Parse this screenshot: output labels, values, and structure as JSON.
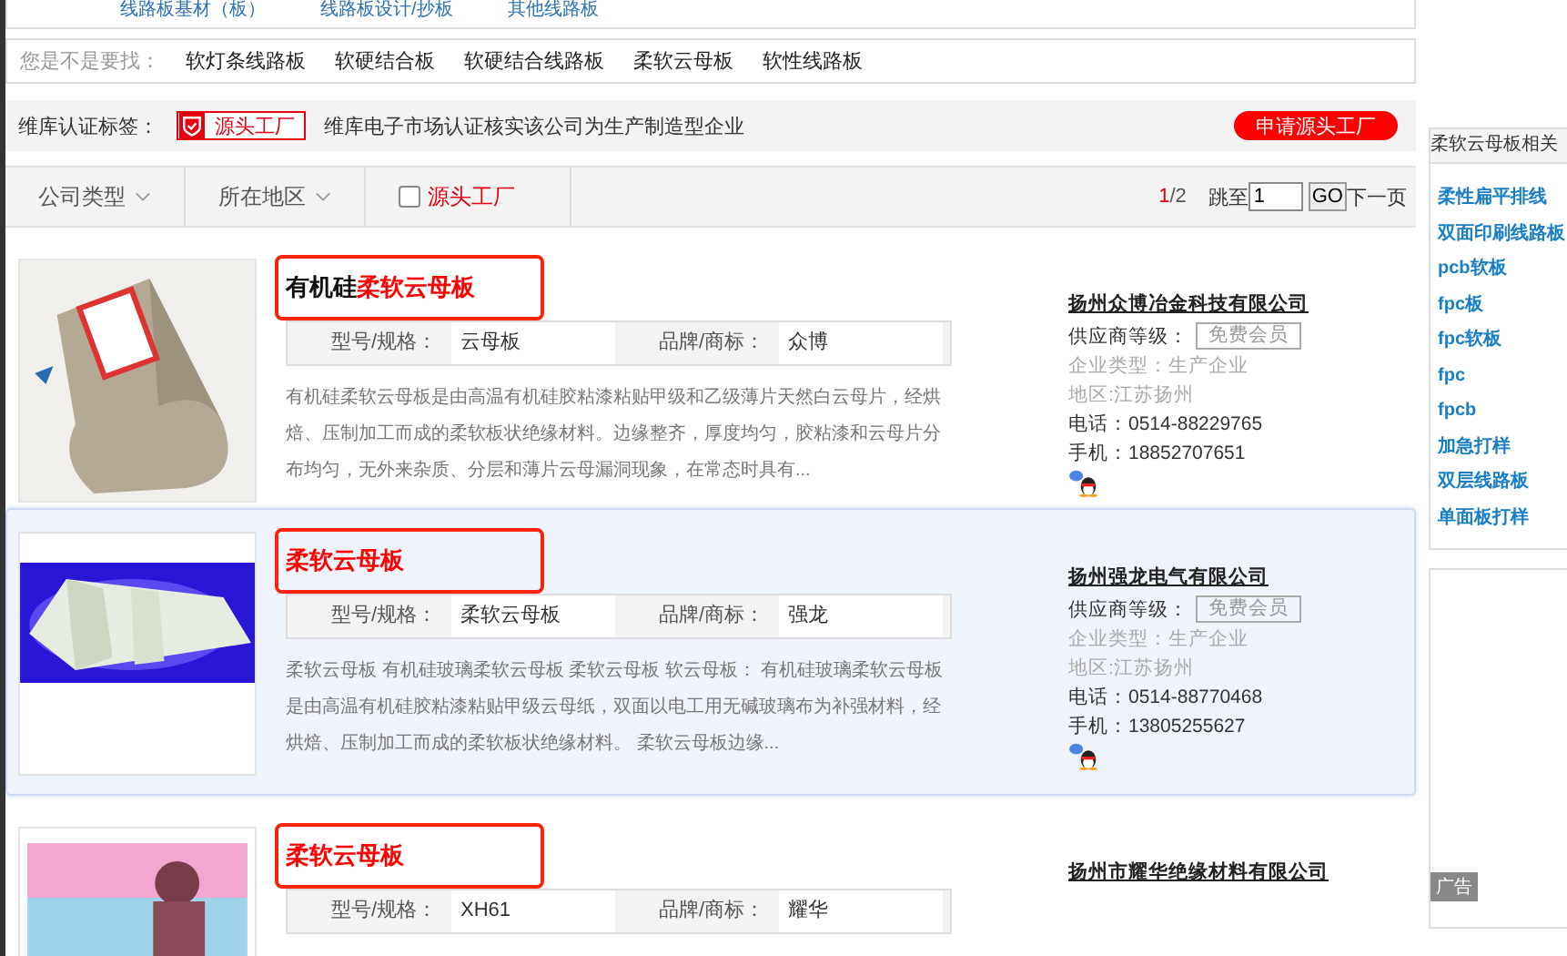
{
  "top_links": [
    "线路板基材（板）",
    "线路板设计/抄板",
    "其他线路板"
  ],
  "suggestions": {
    "label": "您是不是要找：",
    "items": [
      "软灯条线路板",
      "软硬结合板",
      "软硬结合线路板",
      "柔软云母板",
      "软性线路板"
    ]
  },
  "certification": {
    "label": "维库认证标签：",
    "badge": "源头工厂",
    "description": "维库电子市场认证核实该公司为生产制造型企业",
    "apply_button": "申请源头工厂"
  },
  "filters": {
    "dropdowns": [
      "公司类型",
      "所在地区"
    ],
    "checkbox": {
      "label": "源头工厂",
      "checked": false
    }
  },
  "pagination": {
    "current": "1",
    "total": "/2",
    "jump_label": "跳至",
    "page_input": "1",
    "go_button": "GO",
    "next": "下一页"
  },
  "listings": [
    {
      "selected": false,
      "title_prefix": "有机硅",
      "title_highlight": "柔软云母板",
      "specs": [
        {
          "label": "型号/规格：",
          "value": "云母板"
        },
        {
          "label": "品牌/商标：",
          "value": "众博"
        }
      ],
      "description": "有机硅柔软云母板是由高温有机硅胶粘漆粘贴甲级和乙级薄片天然白云母片，经烘焙、压制加工而成的柔软板状绝缘材料。边缘整齐，厚度均匀，胶粘漆和云母片分布均匀，无外来杂质、分层和薄片云母漏洞现象，在常态时具有...",
      "company": "扬州众博冶金科技有限公司",
      "member_label": "供应商等级：",
      "member_badge": "免费会员",
      "company_type": "企业类型：生产企业",
      "region": "地区:江苏扬州",
      "phone": "电话：0514-88229765",
      "mobile": "手机：18852707651"
    },
    {
      "selected": true,
      "title_highlight": "柔软云母板",
      "specs": [
        {
          "label": "型号/规格：",
          "value": "柔软云母板"
        },
        {
          "label": "品牌/商标：",
          "value": "强龙"
        }
      ],
      "description": "柔软云母板 有机硅玻璃柔软云母板 柔软云母板 软云母板： 有机硅玻璃柔软云母板是由高温有机硅胶粘漆粘贴甲级云母纸，双面以电工用无碱玻璃布为补强材料，经烘焙、压制加工而成的柔软板状绝缘材料。 柔软云母板边缘...",
      "company": "扬州强龙电气有限公司",
      "member_label": "供应商等级：",
      "member_badge": "免费会员",
      "company_type": "企业类型：生产企业",
      "region": "地区:江苏扬州",
      "phone": "电话：0514-88770468",
      "mobile": "手机：13805255627"
    },
    {
      "selected": false,
      "title_highlight": "柔软云母板",
      "specs": [
        {
          "label": "型号/规格：",
          "value": "XH61"
        },
        {
          "label": "品牌/商标：",
          "value": "耀华"
        }
      ],
      "company": "扬州市耀华绝缘材料有限公司"
    }
  ],
  "sidebar": {
    "title": "柔软云母板相关",
    "links": [
      "柔性扁平排线",
      "双面印刷线路板",
      "pcb软板",
      "fpc板",
      "fpc软板",
      "fpc",
      "fpcb",
      "加急打样",
      "双层线路板",
      "单面板打样"
    ],
    "ad_label": "广告"
  }
}
